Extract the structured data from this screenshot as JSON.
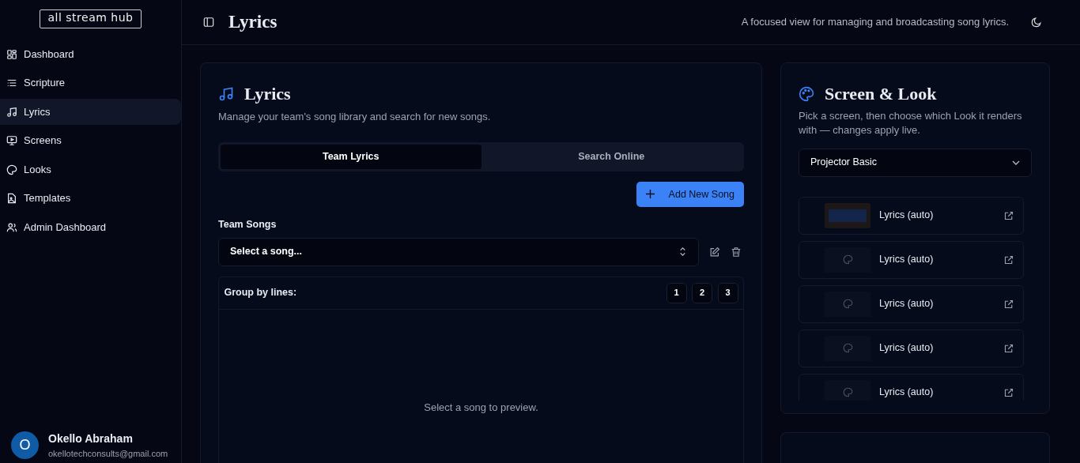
{
  "sidebar": {
    "logo": "all stream hub",
    "items": [
      {
        "label": "Dashboard",
        "selected": false
      },
      {
        "label": "Scripture",
        "selected": false
      },
      {
        "label": "Lyrics",
        "selected": true
      },
      {
        "label": "Screens",
        "selected": false
      },
      {
        "label": "Looks",
        "selected": false
      },
      {
        "label": "Templates",
        "selected": false
      },
      {
        "label": "Admin Dashboard",
        "selected": false
      }
    ],
    "user": {
      "initial": "O",
      "name": "Okello Abraham",
      "email": "okellotechconsults@gmail.com"
    }
  },
  "header": {
    "title": "Lyrics",
    "subtitle": "A focused view for managing and broadcasting song lyrics."
  },
  "lyrics_card": {
    "title": "Lyrics",
    "description": "Manage your team's song library and search for new songs.",
    "tabs": [
      {
        "label": "Team Lyrics",
        "selected": true
      },
      {
        "label": "Search Online",
        "selected": false
      }
    ],
    "add_button": "Add New Song",
    "songs_label": "Team Songs",
    "song_select": {
      "value": "Select a song..."
    },
    "group_label": "Group by lines:",
    "group_options": [
      "1",
      "2",
      "3"
    ],
    "empty_message": "Select a song to preview."
  },
  "screen_card": {
    "title": "Screen & Look",
    "description": "Pick a screen, then choose which Look it renders with — changes apply live.",
    "screen_select": {
      "value": "Projector Basic"
    },
    "looks": [
      {
        "kind": "preview",
        "label": "Lyrics (auto)"
      },
      {
        "kind": "placeholder",
        "label": "Lyrics (auto)"
      },
      {
        "kind": "placeholder",
        "label": "Lyrics (auto)"
      },
      {
        "kind": "placeholder",
        "label": "Lyrics (auto)"
      },
      {
        "kind": "placeholder",
        "label": "Lyrics (auto)"
      }
    ]
  }
}
